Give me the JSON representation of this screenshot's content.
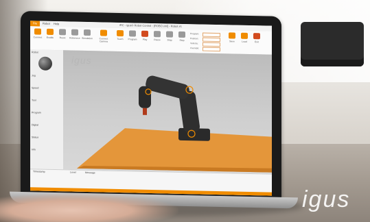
{
  "app": {
    "window_title": "iRC - igus® Robot Control - [ROBO.xml] - Robot #1",
    "menu": [
      "File",
      "Robot",
      "Help"
    ],
    "logo_text": "igus",
    "ribbon": {
      "buttons": [
        "Connect",
        "Enable",
        "Reset",
        "Reference",
        "Simulation",
        "Connect Camera",
        "Teach",
        "Program",
        "Play",
        "Pause",
        "Stop",
        "Step",
        "Save",
        "Load",
        "Exit"
      ],
      "labels": [
        "Program:",
        "Position:",
        "Velocity:",
        "Override:"
      ],
      "values": [
        "",
        "",
        "",
        ""
      ]
    },
    "sidebar": {
      "sections": [
        "Robot",
        "Jog",
        "Speed",
        "Tool",
        "Program",
        "Digital",
        "Status",
        "Info"
      ],
      "values": [
        "",
        "",
        "",
        "",
        "",
        "",
        "",
        ""
      ]
    },
    "status": {
      "headers": [
        "Timestamp",
        "Level",
        "Message"
      ],
      "rows": [
        {
          "time": "",
          "level": "",
          "msg": ""
        },
        {
          "time": "",
          "level": "",
          "msg": ""
        },
        {
          "time": "",
          "level": "",
          "msg": ""
        }
      ],
      "footer": ""
    }
  },
  "watermark": "igus",
  "colors": {
    "accent": "#f08c00",
    "floor": "#e4963a",
    "robot": "#2a2a2a",
    "viewport": "#c9c9c9"
  }
}
